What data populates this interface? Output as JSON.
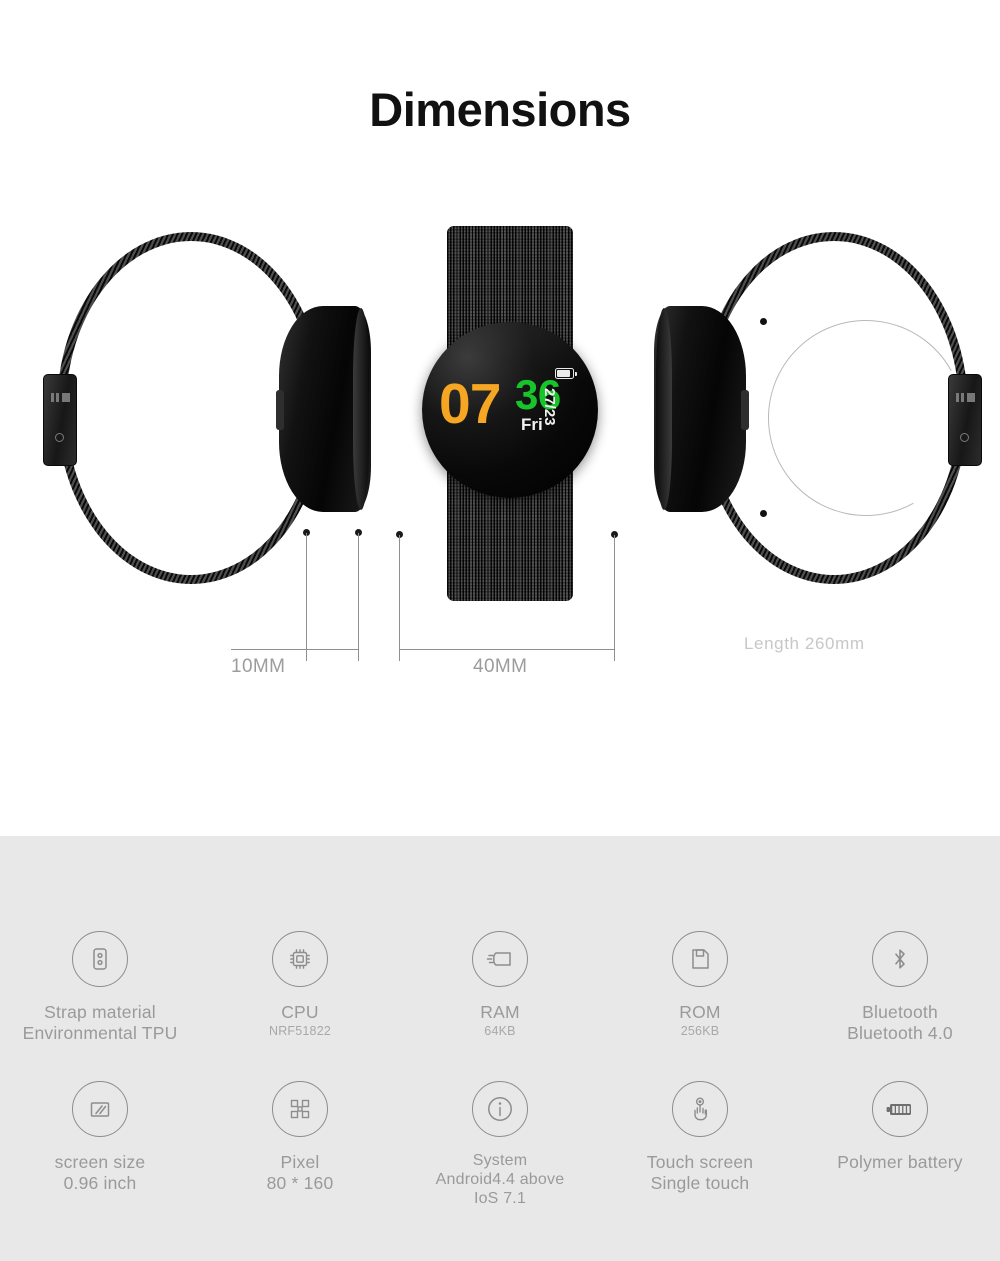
{
  "page": {
    "title": "Dimensions",
    "background_top": "#ffffff",
    "background_bottom": "#e8e8e8"
  },
  "watch_face": {
    "hours": "07",
    "minutes": "36",
    "weekday": "Fri",
    "date": "27/23",
    "hours_color": "#F5A623",
    "minutes_color": "#17C52A",
    "text_color": "#f2f2f2",
    "battery_icon": "battery-icon"
  },
  "dimensions": {
    "thickness_label": "10MM",
    "diameter_label": "40MM",
    "strap_length_label": "Length  260mm",
    "line_color": "#8f8f8f",
    "label_color": "#9c9c9c"
  },
  "specs": {
    "row1": [
      {
        "icon": "strap-icon",
        "line1": "Strap material",
        "line2": "Environmental TPU",
        "sub": ""
      },
      {
        "icon": "cpu-chip-icon",
        "line1": "CPU",
        "line2": "",
        "sub": "NRF51822"
      },
      {
        "icon": "ram-icon",
        "line1": "RAM",
        "line2": "",
        "sub": "64KB"
      },
      {
        "icon": "rom-floppy-icon",
        "line1": "ROM",
        "line2": "",
        "sub": "256KB"
      },
      {
        "icon": "bluetooth-icon",
        "line1": "Bluetooth",
        "line2": "Bluetooth 4.0",
        "sub": ""
      }
    ],
    "row2": [
      {
        "icon": "screen-icon",
        "line1": "screen size",
        "line2": "0.96 inch",
        "line3": "",
        "sub": ""
      },
      {
        "icon": "pixel-grid-icon",
        "line1": "Pixel",
        "line2": "80 * 160",
        "line3": "",
        "sub": ""
      },
      {
        "icon": "info-circle-icon",
        "line1": "System",
        "line2": "Android4.4 above",
        "line3": "IoS 7.1",
        "sub": ""
      },
      {
        "icon": "touch-hand-icon",
        "line1": "Touch screen",
        "line2": "Single touch",
        "line3": "",
        "sub": ""
      },
      {
        "icon": "battery-full-icon",
        "line1": "Polymer battery",
        "line2": "",
        "line3": "",
        "sub": ""
      }
    ]
  }
}
